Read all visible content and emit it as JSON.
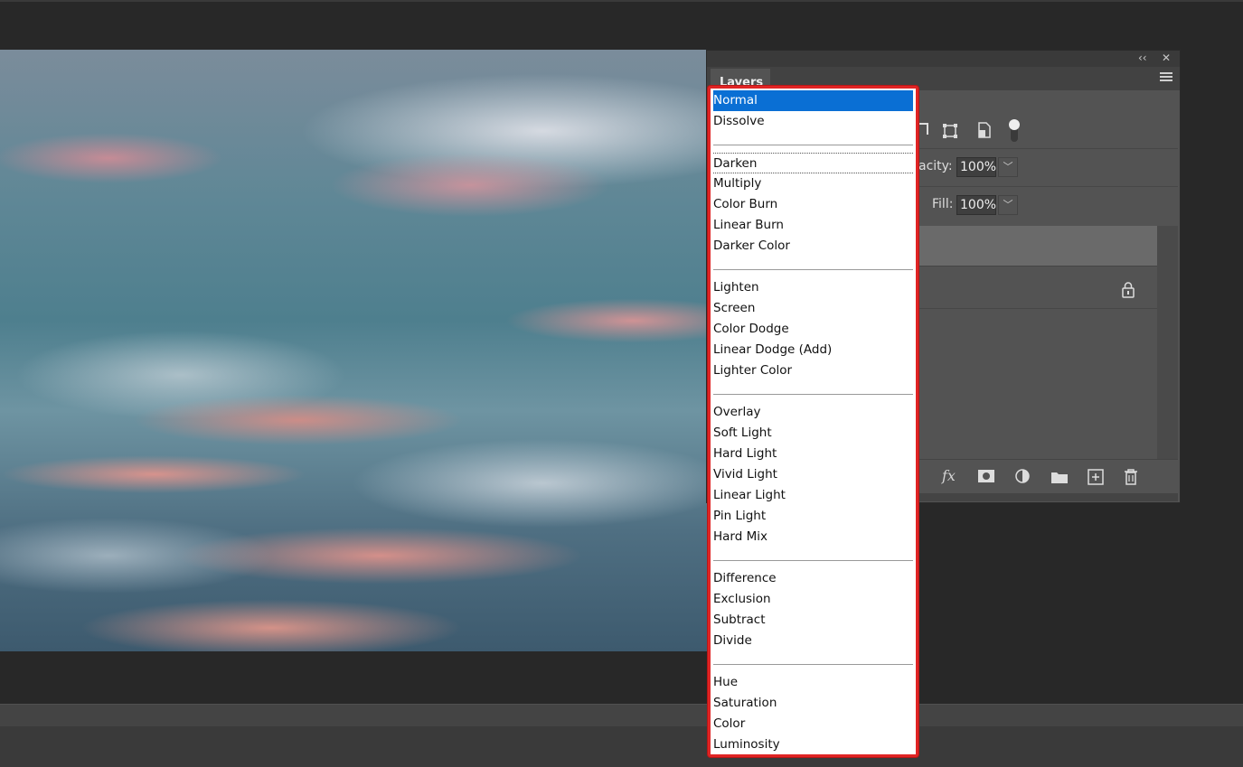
{
  "panel": {
    "title": "Layers",
    "collapse_label": "‹‹",
    "close_label": "✕",
    "opacity_label": "acity:",
    "opacity_value": "100%",
    "fill_label": "Fill:",
    "fill_value": "100%",
    "fx_label": "fx"
  },
  "blend_modes": {
    "selected": "Normal",
    "groups": [
      [
        "Normal",
        "Dissolve"
      ],
      [
        "Darken",
        "Multiply",
        "Color Burn",
        "Linear Burn",
        "Darker Color"
      ],
      [
        "Lighten",
        "Screen",
        "Color Dodge",
        "Linear Dodge (Add)",
        "Lighter Color"
      ],
      [
        "Overlay",
        "Soft Light",
        "Hard Light",
        "Vivid Light",
        "Linear Light",
        "Pin Light",
        "Hard Mix"
      ],
      [
        "Difference",
        "Exclusion",
        "Subtract",
        "Divide"
      ],
      [
        "Hue",
        "Saturation",
        "Color",
        "Luminosity"
      ]
    ]
  },
  "colors": {
    "selection": "#0a6fd4",
    "highlight_border": "#e02424",
    "panel_bg": "#535353"
  }
}
